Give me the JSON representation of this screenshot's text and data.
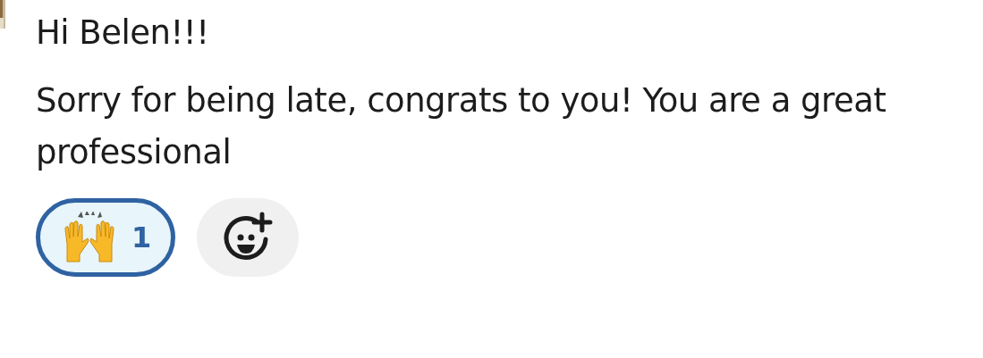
{
  "message": {
    "paragraphs": [
      "Hi Belen!!!",
      "Sorry for being late, congrats to you! You are a great professional"
    ],
    "reactions": [
      {
        "count": "1",
        "selected": true
      }
    ]
  }
}
